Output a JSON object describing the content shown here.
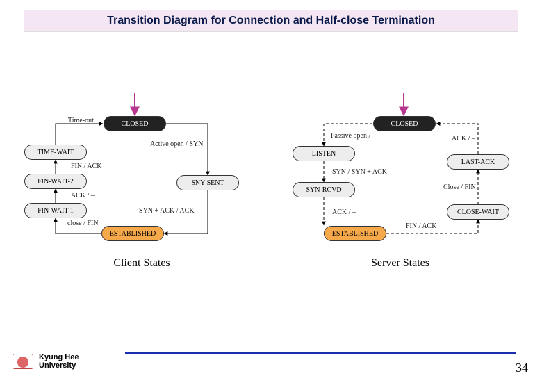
{
  "title": "Transition Diagram for Connection and Half-close Termination",
  "client": {
    "caption": "Client States",
    "states": {
      "closed": "CLOSED",
      "syn_sent": "SNY-SENT",
      "established": "ESTABLISHED",
      "fin_wait_1": "FIN-WAIT-1",
      "fin_wait_2": "FIN-WAIT-2",
      "time_wait": "TIME-WAIT"
    },
    "edges": {
      "active_open": "Active open / SYN",
      "syn_ack": "SYN + ACK / ACK",
      "close_fin": "close / FIN",
      "ack": "ACK / –",
      "fin_ack": "FIN / ACK",
      "timeout": "Time-out"
    }
  },
  "server": {
    "caption": "Server States",
    "states": {
      "closed": "CLOSED",
      "listen": "LISTEN",
      "syn_rcvd": "SYN-RCVD",
      "established": "ESTABLISHED",
      "close_wait": "CLOSE-WAIT",
      "last_ack": "LAST-ACK"
    },
    "edges": {
      "passive_open": "Passive open /",
      "syn_synack": "SYN / SYN + ACK",
      "ack": "ACK / –",
      "fin_ack": "FIN / ACK",
      "close_fin": "Close / FIN",
      "ack_close": "ACK / –"
    }
  },
  "footer": {
    "line1": "Kyung Hee",
    "line2": "University"
  },
  "page_number": "34"
}
